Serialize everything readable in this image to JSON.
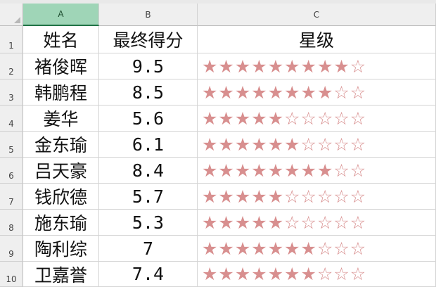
{
  "columns": [
    {
      "label": "A",
      "selected": true
    },
    {
      "label": "B",
      "selected": false
    },
    {
      "label": "C",
      "selected": false
    }
  ],
  "row_numbers": [
    "1",
    "2",
    "3",
    "4",
    "5",
    "6",
    "7",
    "8",
    "9",
    "10"
  ],
  "header": {
    "name": "姓名",
    "score": "最终得分",
    "rating": "星级"
  },
  "records": [
    {
      "name": "褚俊晖",
      "score": "9.5",
      "filled": 9
    },
    {
      "name": "韩鹏程",
      "score": "8.5",
      "filled": 8
    },
    {
      "name": "姜华",
      "score": "5.6",
      "filled": 5
    },
    {
      "name": "金东瑜",
      "score": "6.1",
      "filled": 6
    },
    {
      "name": "吕天豪",
      "score": "8.4",
      "filled": 8
    },
    {
      "name": "钱欣德",
      "score": "5.7",
      "filled": 5
    },
    {
      "name": "施东瑜",
      "score": "5.3",
      "filled": 5
    },
    {
      "name": "陶利综",
      "score": "7",
      "filled": 7
    },
    {
      "name": "卫嘉誉",
      "score": "7.4",
      "filled": 7
    }
  ],
  "star_total": 10,
  "star_filled_glyph": "★",
  "star_empty_glyph": "☆",
  "colors": {
    "star": "#d88f8f",
    "selected_header": "#9fd5b7",
    "accent": "#217346"
  }
}
